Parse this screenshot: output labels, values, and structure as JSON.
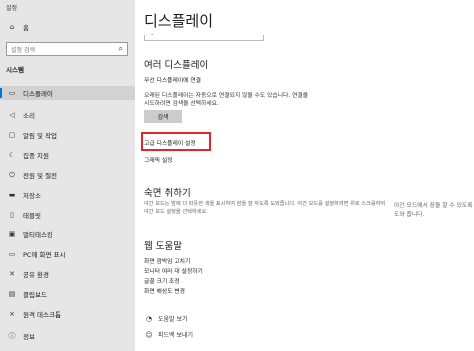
{
  "window": {
    "title": "설정"
  },
  "sidebar": {
    "home_label": "홈",
    "search_placeholder": "설정 검색",
    "section_title": "시스템",
    "items": [
      {
        "icon": "monitor-icon",
        "label": "디스플레이",
        "active": true
      },
      {
        "icon": "speaker-icon",
        "label": "소리",
        "active": false
      },
      {
        "icon": "notification-icon",
        "label": "알림 및 작업",
        "active": false
      },
      {
        "icon": "moon-icon",
        "label": "집중 지원",
        "active": false
      },
      {
        "icon": "power-icon",
        "label": "전원 및 절전",
        "active": false
      },
      {
        "icon": "storage-icon",
        "label": "저장소",
        "active": false
      },
      {
        "icon": "tablet-icon",
        "label": "태블릿",
        "active": false
      },
      {
        "icon": "multitask-icon",
        "label": "멀티태스킹",
        "active": false
      },
      {
        "icon": "project-icon",
        "label": "PC에 화면 표시",
        "active": false
      },
      {
        "icon": "shared-icon",
        "label": "공유 환경",
        "active": false
      },
      {
        "icon": "clipboard-icon",
        "label": "클립보드",
        "active": false
      },
      {
        "icon": "remote-icon",
        "label": "원격 데스크톱",
        "active": false
      },
      {
        "icon": "info-icon",
        "label": "정보",
        "active": false
      }
    ]
  },
  "main": {
    "title": "디스플레이",
    "scroll_hint": "-",
    "multi": {
      "heading": "여러 디스플레이",
      "wireless_link": "무선 디스플레이에 연결",
      "desc_line1": "오래된 디스플레이는 자동으로 연결되지 않을 수도 있습니다. 연결을",
      "desc_line2": "시도하려면 검색을 선택하세요.",
      "detect_button": "검색",
      "advanced_link": "고급 디스플레이 설정",
      "graphics_link": "그래픽 설정"
    },
    "sleep": {
      "heading": "숙면 취하기",
      "desc": "야간 모드는 밤에 더 따뜻한 색을 표시하여 잠을 잘 자도록 도와줍니다. 야간 모드를 설정하려면 위로 스크롤하여 야간 모드 설정을 선택하세요.",
      "side": "야간 모드에서 잠을 잘 수 있도록 도와 줍니다."
    },
    "help": {
      "heading": "웹 도움말",
      "links": [
        "화면 깜박임 고치기",
        "모니터 여러 대 설정하기",
        "글꼴 크기 조정",
        "화면 해상도 변경"
      ],
      "help_label": "도움말 보기",
      "feedback_label": "피드백 보내기"
    }
  }
}
